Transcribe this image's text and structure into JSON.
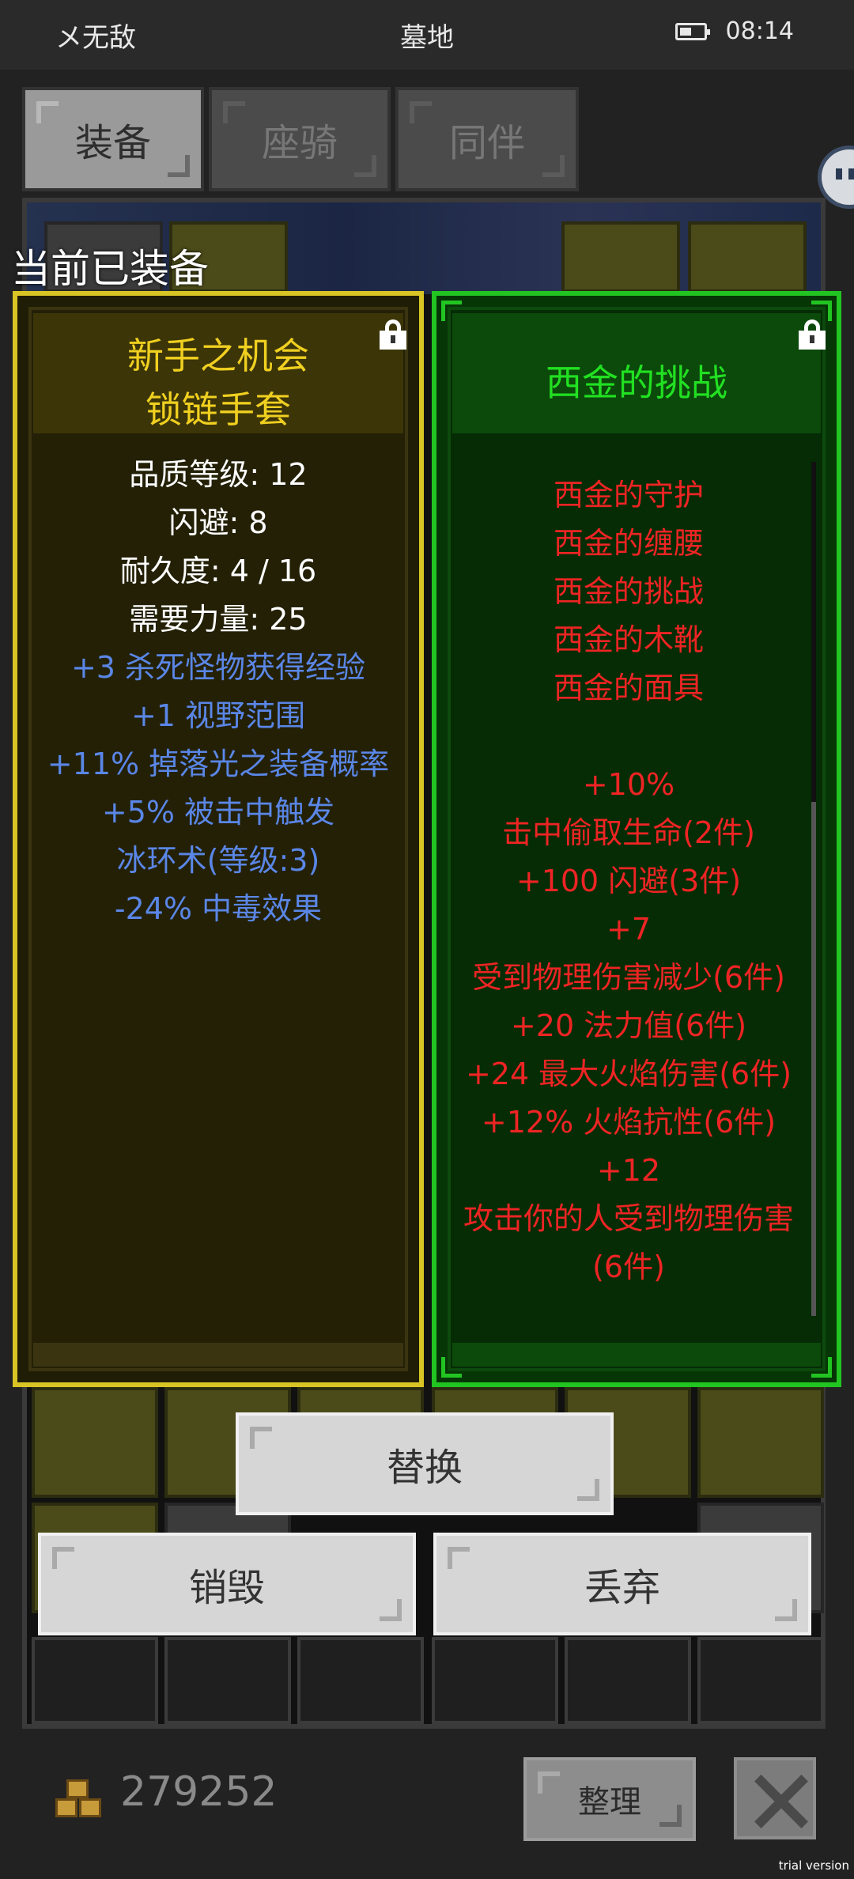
{
  "status_bar": {
    "carrier": "メ无敌",
    "title": "墓地",
    "time": "08:14",
    "battery_level": 0.6
  },
  "tabs": [
    {
      "label": "装备",
      "active": true
    },
    {
      "label": "座骑",
      "active": false
    },
    {
      "label": "同伴",
      "active": false
    }
  ],
  "section_label": "当前已装备",
  "left_card": {
    "title_line1": "新手之机会",
    "title_line2": "锁链手套",
    "stats": [
      {
        "text": "品质等级: 12",
        "color": "white"
      },
      {
        "text": "闪避: 8",
        "color": "white"
      },
      {
        "text": "耐久度: 4 / 16",
        "color": "white"
      },
      {
        "text": "需要力量: 25",
        "color": "white"
      },
      {
        "text": "+3 杀死怪物获得经验",
        "color": "blue"
      },
      {
        "text": "+1 视野范围",
        "color": "blue"
      },
      {
        "text": "+11% 掉落光之装备概率",
        "color": "blue"
      },
      {
        "text": "+5% 被击中触发",
        "color": "blue"
      },
      {
        "text": "冰环术(等级:3)",
        "color": "blue"
      },
      {
        "text": "-24% 中毒效果",
        "color": "blue"
      }
    ],
    "border_color": "#d8c424",
    "title_color": "#f0d020"
  },
  "right_card": {
    "title": "西金的挑战",
    "set_items": [
      "西金的守护",
      "西金的缠腰",
      "西金的挑战",
      "西金的木靴",
      "西金的面具"
    ],
    "set_bonuses": [
      "+10%",
      "击中偷取生命(2件)",
      "+100 闪避(3件)",
      "+7",
      "受到物理伤害减少(6件)",
      "+20 法力值(6件)",
      "+24 最大火焰伤害(6件)",
      "+12% 火焰抗性(6件)",
      "+12",
      "攻击你的人受到物理伤害",
      "(6件)"
    ],
    "border_color": "#22c422",
    "title_color": "#22e022",
    "text_color": "#ee2424"
  },
  "buttons": {
    "replace": "替换",
    "destroy": "销毁",
    "discard": "丢弃",
    "sort": "整理"
  },
  "icons": {
    "lock": "lock-icon",
    "close": "close-icon",
    "gold": "gold-coins-icon"
  },
  "gold": "279252",
  "watermark": "trial version"
}
